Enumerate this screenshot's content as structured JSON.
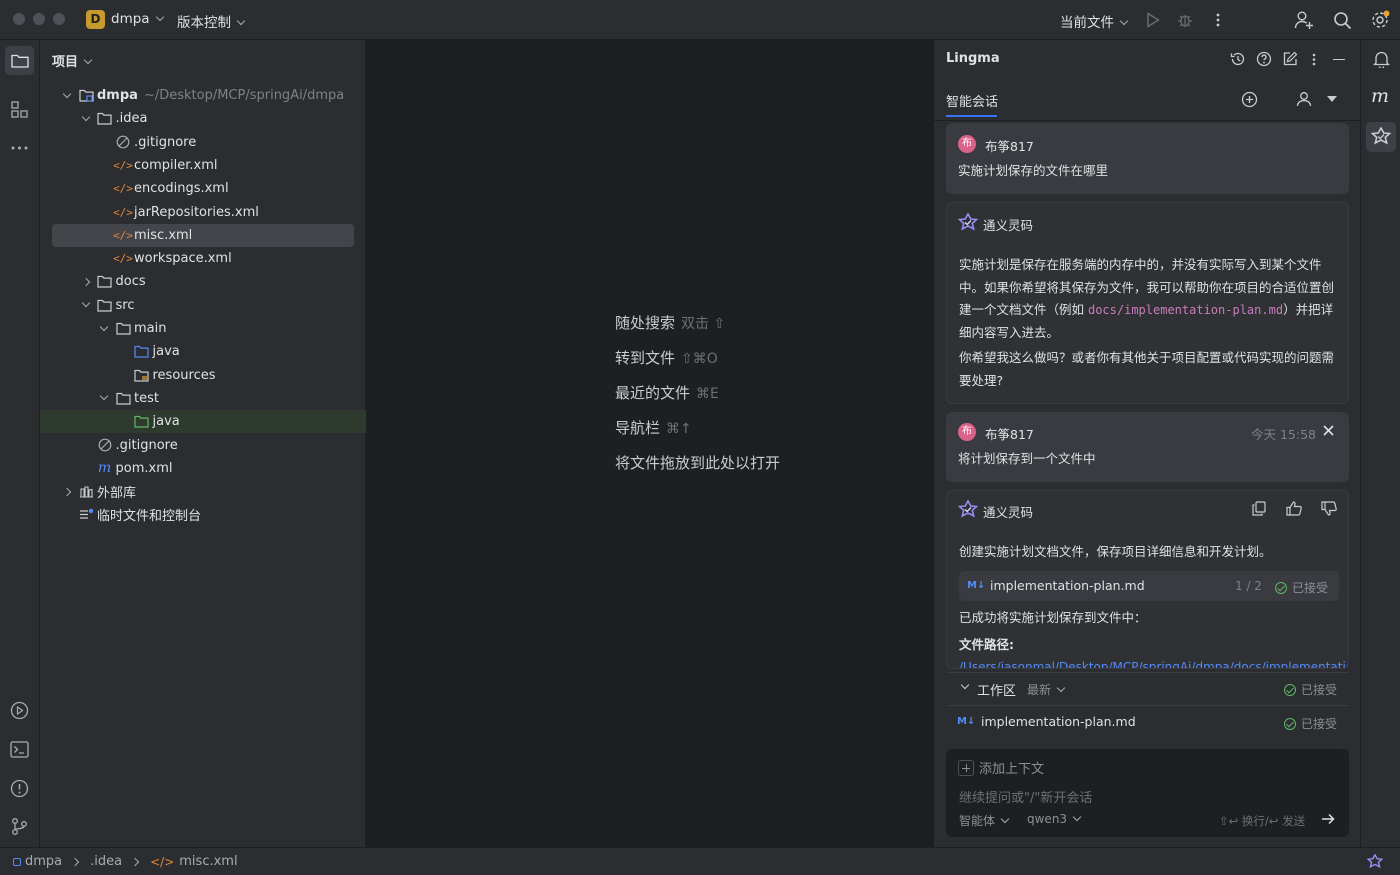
{
  "titlebar": {
    "project_initial": "D",
    "project_name": "dmpa",
    "vcs_label": "版本控制",
    "run_config": "当前文件"
  },
  "project_panel": {
    "title": "项目",
    "tree": [
      {
        "label": "dmpa",
        "hint": "~/Desktop/MCP/springAi/dmpa",
        "depth": 0,
        "type": "module",
        "expanded": true,
        "bold": true
      },
      {
        "label": ".idea",
        "depth": 1,
        "type": "folder",
        "expanded": true
      },
      {
        "label": ".gitignore",
        "depth": 2,
        "type": "ignore"
      },
      {
        "label": "compiler.xml",
        "depth": 2,
        "type": "xml"
      },
      {
        "label": "encodings.xml",
        "depth": 2,
        "type": "xml"
      },
      {
        "label": "jarRepositories.xml",
        "depth": 2,
        "type": "xml"
      },
      {
        "label": "misc.xml",
        "depth": 2,
        "type": "xml",
        "selected": true
      },
      {
        "label": "workspace.xml",
        "depth": 2,
        "type": "xml"
      },
      {
        "label": "docs",
        "depth": 1,
        "type": "folder",
        "expanded": false
      },
      {
        "label": "src",
        "depth": 1,
        "type": "folder",
        "expanded": true
      },
      {
        "label": "main",
        "depth": 2,
        "type": "folder",
        "expanded": true
      },
      {
        "label": "java",
        "depth": 3,
        "type": "src-folder"
      },
      {
        "label": "resources",
        "depth": 3,
        "type": "res-folder"
      },
      {
        "label": "test",
        "depth": 2,
        "type": "folder",
        "expanded": true
      },
      {
        "label": "java",
        "depth": 3,
        "type": "test-folder",
        "highlight": true
      },
      {
        "label": ".gitignore",
        "depth": 1,
        "type": "ignore"
      },
      {
        "label": "pom.xml",
        "depth": 1,
        "type": "maven"
      },
      {
        "label": "外部库",
        "depth": 0,
        "type": "library",
        "expanded": false
      },
      {
        "label": "临时文件和控制台",
        "depth": 0,
        "type": "scratch"
      }
    ]
  },
  "editor": {
    "hints": [
      {
        "label": "随处搜索",
        "key": "双击 ⇧"
      },
      {
        "label": "转到文件",
        "key": "⇧⌘O"
      },
      {
        "label": "最近的文件",
        "key": "⌘E"
      },
      {
        "label": "导航栏",
        "key": "⌘↑"
      },
      {
        "label": "将文件拖放到此处以打开",
        "key": ""
      }
    ]
  },
  "ai_panel": {
    "title": "Lingma",
    "tab": "智能会话",
    "messages": {
      "user1_name": "布筝817",
      "user1_avatar": "布",
      "user1_text": "实施计划保存的文件在哪里",
      "bot_name": "通义灵码",
      "bot1_text_a": "实施计划是保存在服务端的内存中的，并没有实际写入到某个文件中。如果你希望将其保存为文件，我可以帮助你在项目的合适位置创建一个文档文件（例如 ",
      "bot1_code": "docs/implementation-plan.md",
      "bot1_text_b": "）并把详细内容写入进去。",
      "bot1_text_c": "你希望我这么做吗？或者你有其他关于项目配置或代码实现的问题需要处理?",
      "user2_time": "今天 15:58",
      "user2_text": "将计划保存到一个文件中",
      "bot2_text": "创建实施计划文档文件，保存项目详细信息和开发计划。",
      "file_badge": "M↓",
      "file_name": "implementation-plan.md",
      "file_count": "1 / 2",
      "accepted_label": "已接受",
      "bot2_saved": "已成功将实施计划保存到文件中：",
      "bot2_path_label": "文件路径:",
      "bot2_path": "/Users/jasonmal/Desktop/MCP/springAi/dmpa/docs/implementation-plan.md"
    },
    "workspace": {
      "title": "工作区",
      "filter": "最新",
      "status": "已接受",
      "file_badge": "M↓",
      "file_name": "implementation-plan.md",
      "file_status": "已接受"
    },
    "input": {
      "add_context": "添加上下文",
      "placeholder": "继续提问或\"/\"新开会话",
      "mode": "智能体",
      "model": "qwen3",
      "send_hint": "⇧↩ 换行/↩ 发送"
    }
  },
  "statusbar": {
    "crumbs": [
      "dmpa",
      ".idea",
      "misc.xml"
    ]
  },
  "colors": {
    "accent": "#3574f0",
    "folder_blue": "#548af7",
    "xml_orange": "#e5873a",
    "check_green": "#5fb865"
  }
}
